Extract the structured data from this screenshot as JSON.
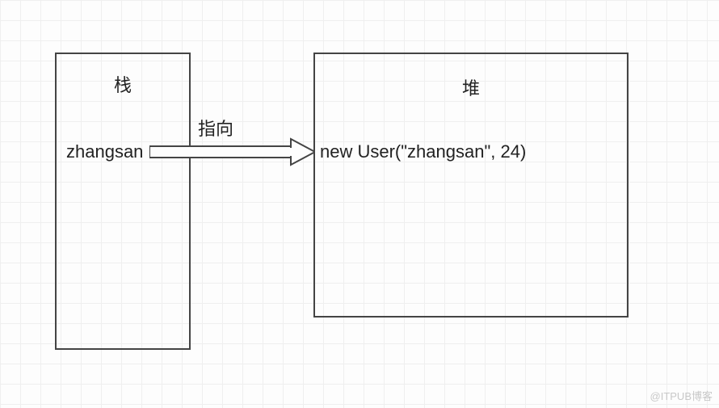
{
  "diagram": {
    "stack": {
      "title": "栈",
      "variable": "zhangsan"
    },
    "heap": {
      "title": "堆",
      "object": "new User(\"zhangsan\", 24)"
    },
    "arrow": {
      "label": "指向"
    }
  },
  "watermark": "@ITPUB博客"
}
